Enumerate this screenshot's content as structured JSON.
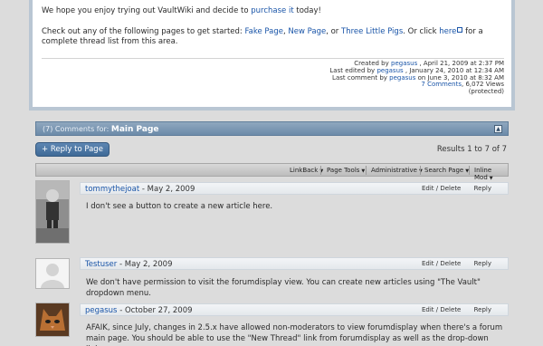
{
  "article": {
    "paragraph1_prefix": "We hope you enjoy trying out VaultWiki and decide to",
    "paragraph1_link": "purchase it",
    "paragraph1_suffix": "today!",
    "paragraph2_prefix": "Check out any of the following pages to get started:",
    "links": [
      "Fake Page",
      "New Page",
      "Three Little Pigs"
    ],
    "sep1": ",",
    "sep2": ", or",
    "or_click": ". Or click",
    "here_link": "here",
    "paragraph2_suffix": "for a complete thread list from this area.",
    "meta": {
      "created_label": "Created by",
      "created_user": "pegasus",
      "created_date": ", April 21, 2009 at 2:37 PM",
      "edited_label": "Last edited by",
      "edited_user": "pegasus",
      "edited_date": ", January 24, 2010 at 12:34 AM",
      "comment_label": "Last comment by",
      "comment_user": "pegasus",
      "comment_date": "on June 3, 2010 at 8:32 AM",
      "comments_count": "7 Comments",
      "views": ", 6,072 Views",
      "status": "(protected)"
    }
  },
  "comments_header": {
    "prefix": "(7) Comments for:",
    "title": "Main Page",
    "collapse_icon": "collapse-icon"
  },
  "reply_button": "+ Reply to Page",
  "results_text": "Results 1 to 7 of 7",
  "toolbar": {
    "items": [
      "LinkBack",
      "Page Tools",
      "Administrative",
      "Search Page",
      "Inline Mod"
    ]
  },
  "comments": [
    {
      "user": "tommythejoat",
      "date": "- May 2, 2009",
      "edit_delete": "Edit / Delete",
      "reply": "Reply",
      "body": "I don't see a button to create a new article here."
    },
    {
      "user": "Testuser",
      "date": "- May 2, 2009",
      "edit_delete": "Edit / Delete",
      "reply": "Reply",
      "body": "We don't have permission to visit the forumdisplay view. You can create new articles using \"The Vault\" dropdown menu."
    },
    {
      "user": "pegasus",
      "date": "- October 27, 2009",
      "edit_delete": "Edit / Delete",
      "reply": "Reply",
      "body": "AFAIK, since July, changes in 2.5.x have allowed non-moderators to view forumdisplay when there's a forum main page. You should be able to use the \"New Thread\" link from forumdisplay as well as the drop-down link."
    }
  ]
}
